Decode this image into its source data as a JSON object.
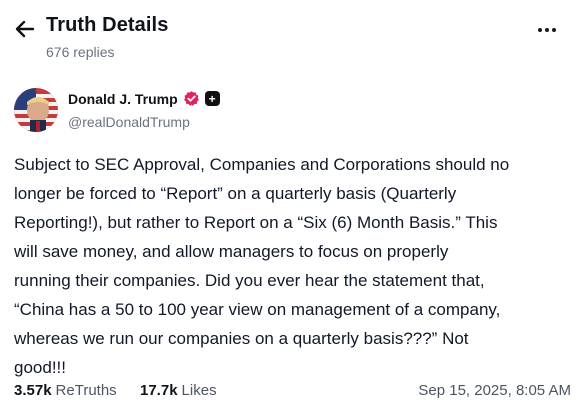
{
  "header": {
    "title": "Truth Details",
    "replies": "676 replies",
    "back_icon": "arrow-left-icon",
    "more_icon": "more-horizontal-icon"
  },
  "author": {
    "name": "Donald J. Trump",
    "handle": "@realDonaldTrump",
    "verified_color": "#e0245e",
    "badge_label": "+"
  },
  "post": {
    "text": "Subject to SEC Approval, Companies and Corporations should no\nlonger be forced to “Report” on a quarterly basis (Quarterly\nReporting!), but rather to Report on a “Six (6) Month Basis.” This\nwill save money, and allow managers to focus on properly\nrunning their companies. Did you ever hear the statement that,\n“China has a 50 to 100 year view on management of a company,\nwhereas we run our companies on a quarterly basis???” Not\ngood!!!"
  },
  "stats": {
    "retruths_count": "3.57k",
    "retruths_label": "ReTruths",
    "likes_count": "17.7k",
    "likes_label": "Likes",
    "timestamp": "Sep 15, 2025, 8:05 AM"
  }
}
